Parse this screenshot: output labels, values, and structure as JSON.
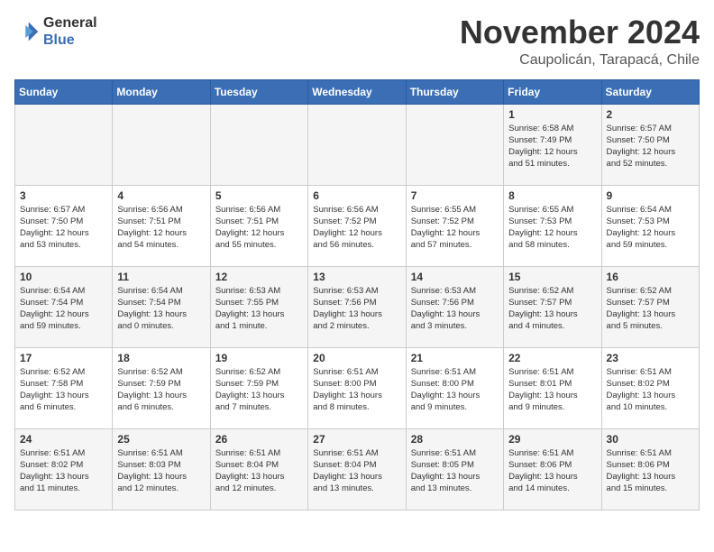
{
  "logo": {
    "line1": "General",
    "line2": "Blue"
  },
  "title": "November 2024",
  "location": "Caupolicán, Tarapacá, Chile",
  "days_of_week": [
    "Sunday",
    "Monday",
    "Tuesday",
    "Wednesday",
    "Thursday",
    "Friday",
    "Saturday"
  ],
  "weeks": [
    [
      {
        "day": "",
        "info": ""
      },
      {
        "day": "",
        "info": ""
      },
      {
        "day": "",
        "info": ""
      },
      {
        "day": "",
        "info": ""
      },
      {
        "day": "",
        "info": ""
      },
      {
        "day": "1",
        "info": "Sunrise: 6:58 AM\nSunset: 7:49 PM\nDaylight: 12 hours\nand 51 minutes."
      },
      {
        "day": "2",
        "info": "Sunrise: 6:57 AM\nSunset: 7:50 PM\nDaylight: 12 hours\nand 52 minutes."
      }
    ],
    [
      {
        "day": "3",
        "info": "Sunrise: 6:57 AM\nSunset: 7:50 PM\nDaylight: 12 hours\nand 53 minutes."
      },
      {
        "day": "4",
        "info": "Sunrise: 6:56 AM\nSunset: 7:51 PM\nDaylight: 12 hours\nand 54 minutes."
      },
      {
        "day": "5",
        "info": "Sunrise: 6:56 AM\nSunset: 7:51 PM\nDaylight: 12 hours\nand 55 minutes."
      },
      {
        "day": "6",
        "info": "Sunrise: 6:56 AM\nSunset: 7:52 PM\nDaylight: 12 hours\nand 56 minutes."
      },
      {
        "day": "7",
        "info": "Sunrise: 6:55 AM\nSunset: 7:52 PM\nDaylight: 12 hours\nand 57 minutes."
      },
      {
        "day": "8",
        "info": "Sunrise: 6:55 AM\nSunset: 7:53 PM\nDaylight: 12 hours\nand 58 minutes."
      },
      {
        "day": "9",
        "info": "Sunrise: 6:54 AM\nSunset: 7:53 PM\nDaylight: 12 hours\nand 59 minutes."
      }
    ],
    [
      {
        "day": "10",
        "info": "Sunrise: 6:54 AM\nSunset: 7:54 PM\nDaylight: 12 hours\nand 59 minutes."
      },
      {
        "day": "11",
        "info": "Sunrise: 6:54 AM\nSunset: 7:54 PM\nDaylight: 13 hours\nand 0 minutes."
      },
      {
        "day": "12",
        "info": "Sunrise: 6:53 AM\nSunset: 7:55 PM\nDaylight: 13 hours\nand 1 minute."
      },
      {
        "day": "13",
        "info": "Sunrise: 6:53 AM\nSunset: 7:56 PM\nDaylight: 13 hours\nand 2 minutes."
      },
      {
        "day": "14",
        "info": "Sunrise: 6:53 AM\nSunset: 7:56 PM\nDaylight: 13 hours\nand 3 minutes."
      },
      {
        "day": "15",
        "info": "Sunrise: 6:52 AM\nSunset: 7:57 PM\nDaylight: 13 hours\nand 4 minutes."
      },
      {
        "day": "16",
        "info": "Sunrise: 6:52 AM\nSunset: 7:57 PM\nDaylight: 13 hours\nand 5 minutes."
      }
    ],
    [
      {
        "day": "17",
        "info": "Sunrise: 6:52 AM\nSunset: 7:58 PM\nDaylight: 13 hours\nand 6 minutes."
      },
      {
        "day": "18",
        "info": "Sunrise: 6:52 AM\nSunset: 7:59 PM\nDaylight: 13 hours\nand 6 minutes."
      },
      {
        "day": "19",
        "info": "Sunrise: 6:52 AM\nSunset: 7:59 PM\nDaylight: 13 hours\nand 7 minutes."
      },
      {
        "day": "20",
        "info": "Sunrise: 6:51 AM\nSunset: 8:00 PM\nDaylight: 13 hours\nand 8 minutes."
      },
      {
        "day": "21",
        "info": "Sunrise: 6:51 AM\nSunset: 8:00 PM\nDaylight: 13 hours\nand 9 minutes."
      },
      {
        "day": "22",
        "info": "Sunrise: 6:51 AM\nSunset: 8:01 PM\nDaylight: 13 hours\nand 9 minutes."
      },
      {
        "day": "23",
        "info": "Sunrise: 6:51 AM\nSunset: 8:02 PM\nDaylight: 13 hours\nand 10 minutes."
      }
    ],
    [
      {
        "day": "24",
        "info": "Sunrise: 6:51 AM\nSunset: 8:02 PM\nDaylight: 13 hours\nand 11 minutes."
      },
      {
        "day": "25",
        "info": "Sunrise: 6:51 AM\nSunset: 8:03 PM\nDaylight: 13 hours\nand 12 minutes."
      },
      {
        "day": "26",
        "info": "Sunrise: 6:51 AM\nSunset: 8:04 PM\nDaylight: 13 hours\nand 12 minutes."
      },
      {
        "day": "27",
        "info": "Sunrise: 6:51 AM\nSunset: 8:04 PM\nDaylight: 13 hours\nand 13 minutes."
      },
      {
        "day": "28",
        "info": "Sunrise: 6:51 AM\nSunset: 8:05 PM\nDaylight: 13 hours\nand 13 minutes."
      },
      {
        "day": "29",
        "info": "Sunrise: 6:51 AM\nSunset: 8:06 PM\nDaylight: 13 hours\nand 14 minutes."
      },
      {
        "day": "30",
        "info": "Sunrise: 6:51 AM\nSunset: 8:06 PM\nDaylight: 13 hours\nand 15 minutes."
      }
    ]
  ]
}
